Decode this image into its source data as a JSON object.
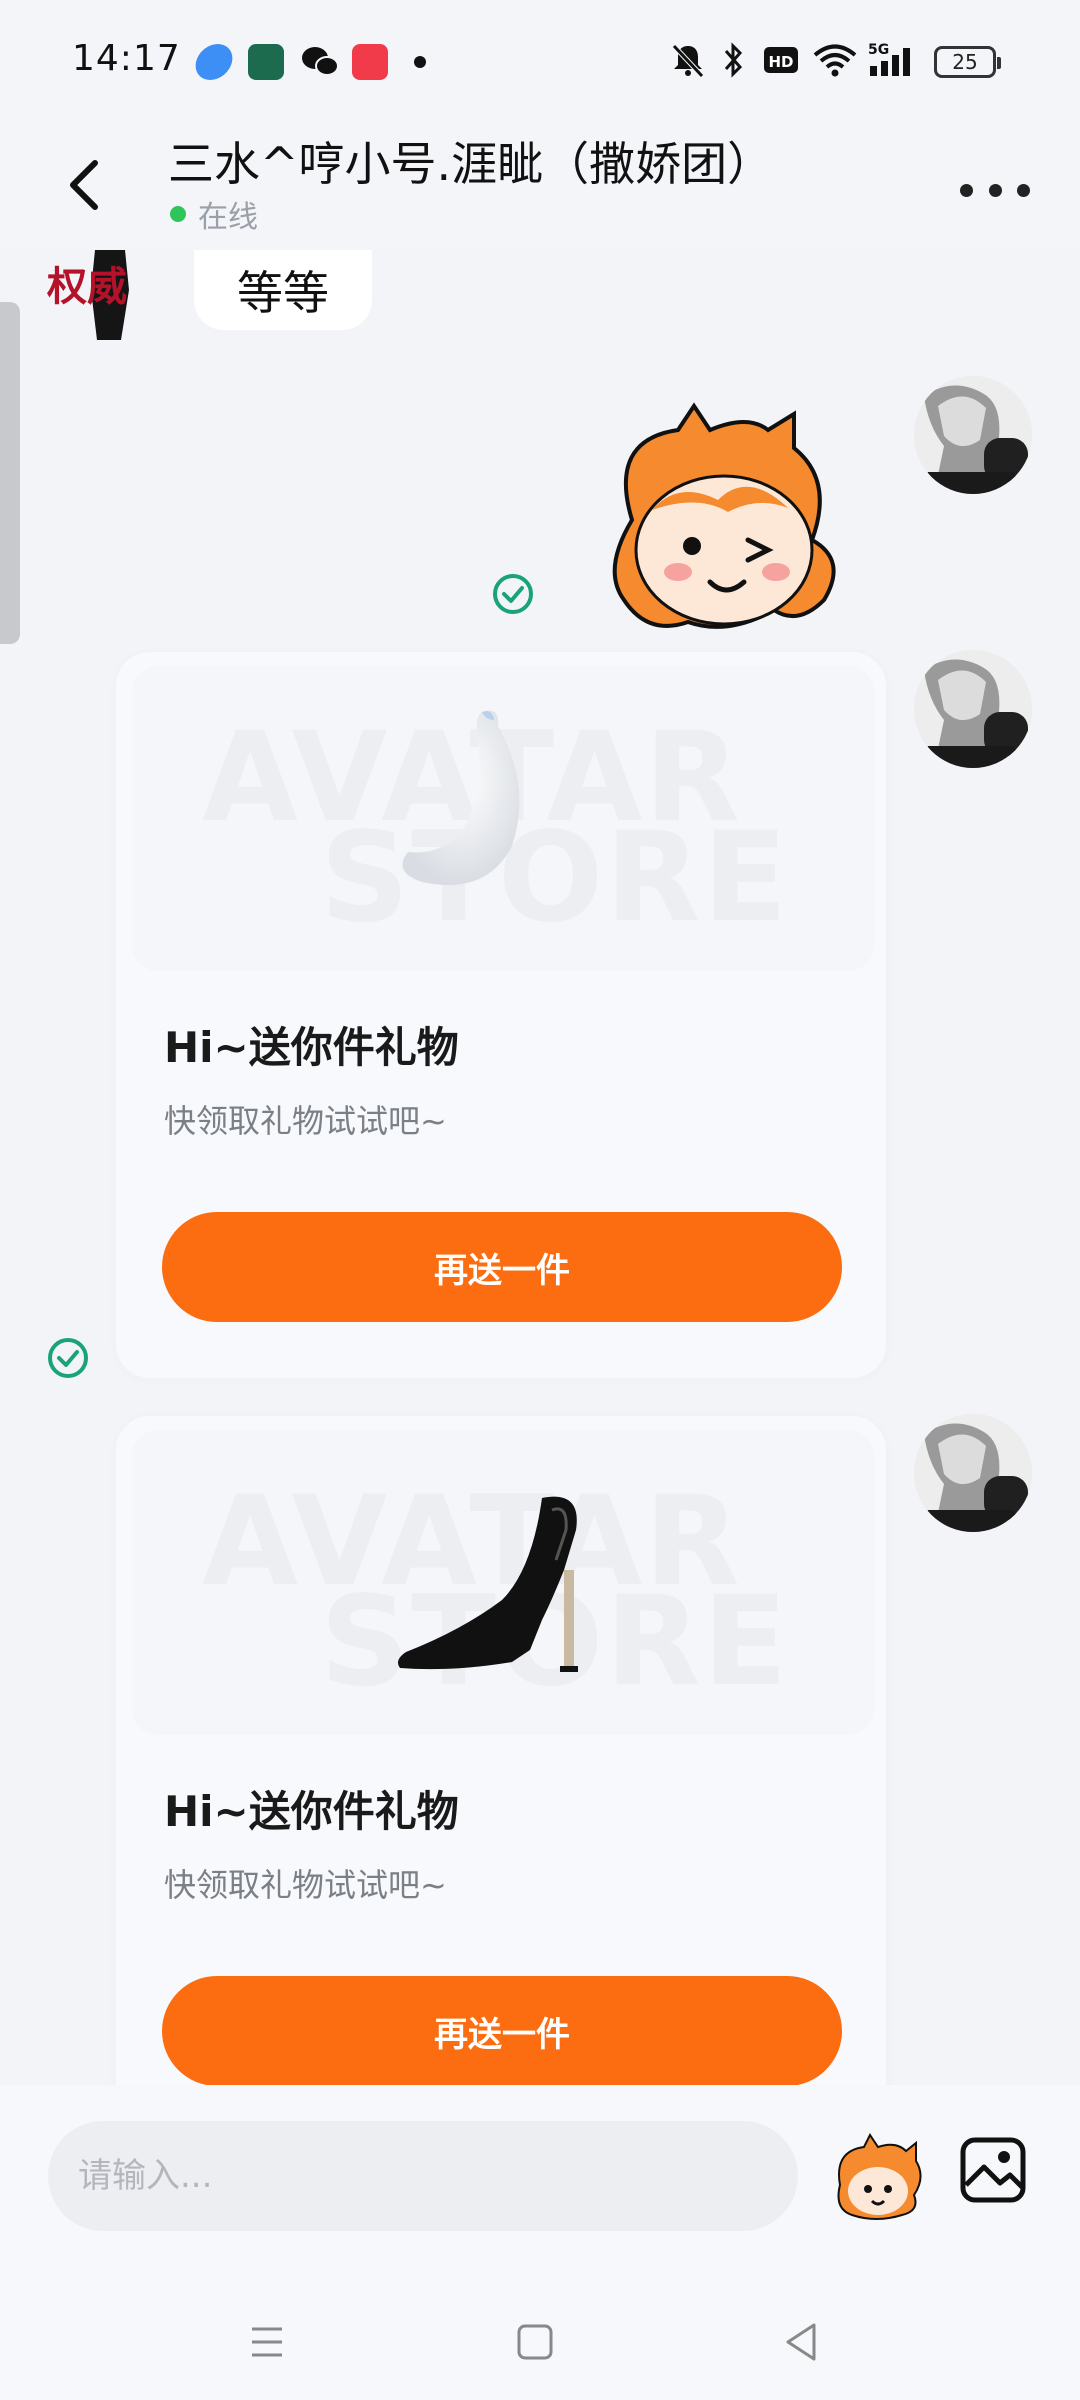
{
  "status_bar": {
    "time": "14:17",
    "battery": "25",
    "network": "5G"
  },
  "header": {
    "title": "三水^哼小号.涯眦（撒娇团）",
    "status": "在线"
  },
  "messages": {
    "incoming_text": "等等",
    "other_avatar_text": "权威",
    "gift_cards": [
      {
        "watermark_line1": "AVATAR",
        "watermark_line2": "STORE",
        "title": "Hi~送你件礼物",
        "subtitle": "快领取礼物试试吧~",
        "button_label": "再送一件"
      },
      {
        "watermark_line1": "AVATAR",
        "watermark_line2": "STORE",
        "title": "Hi~送你件礼物",
        "subtitle": "快领取礼物试试吧~",
        "button_label": "再送一件"
      }
    ]
  },
  "input_bar": {
    "placeholder": "请输入..."
  },
  "colors": {
    "accent_orange": "#fb6d10",
    "online_green": "#2ec65a",
    "read_check_green": "#1aa37a"
  },
  "icons": {
    "back": "chevron-left-icon",
    "more": "more-horizontal-icon",
    "emoji": "sticker-mascot-icon",
    "image": "image-icon",
    "read": "check-circle-icon"
  }
}
